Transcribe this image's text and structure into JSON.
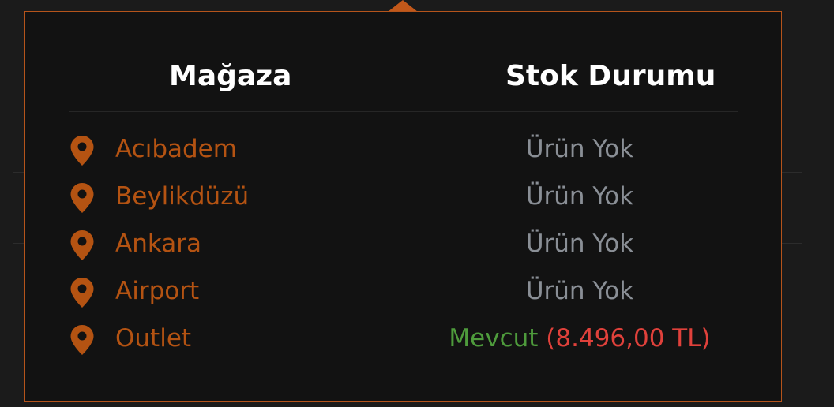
{
  "popup": {
    "headers": {
      "store": "Mağaza",
      "stock": "Stok Durumu"
    },
    "rows": [
      {
        "store": "Acıbadem",
        "status": "Ürün Yok",
        "price": ""
      },
      {
        "store": "Beylikdüzü",
        "status": "Ürün Yok",
        "price": ""
      },
      {
        "store": "Ankara",
        "status": "Ürün Yok",
        "price": ""
      },
      {
        "store": "Airport",
        "status": "Ürün Yok",
        "price": ""
      },
      {
        "store": "Outlet",
        "status": "Mevcut",
        "price": "(8.496,00 TL)"
      }
    ],
    "icon": "location-pin-icon"
  },
  "colors": {
    "accent": "#b45312",
    "border": "#b5541b",
    "available": "#4e9b3c",
    "price": "#e0413b",
    "unavailable": "#8a8f96"
  }
}
